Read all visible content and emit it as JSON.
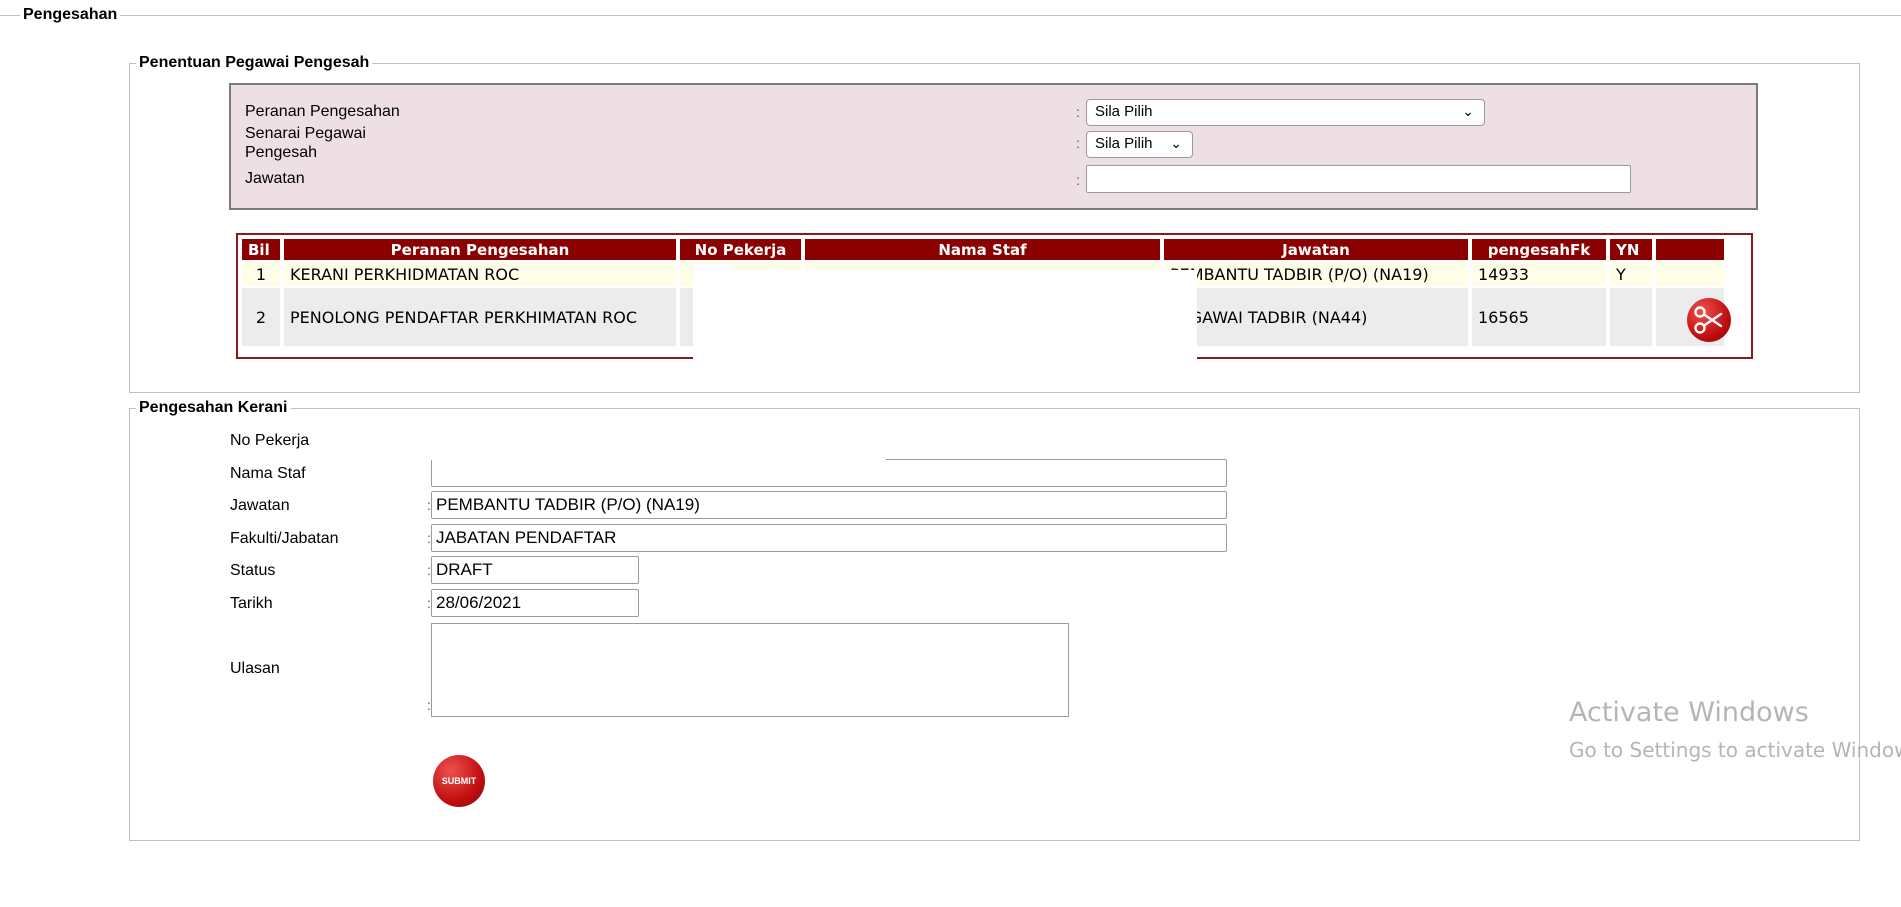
{
  "main": {
    "legend": "Pengesahan"
  },
  "assign": {
    "legend": "Penentuan Pegawai Pengesah",
    "role_label": "Peranan Pengesahan",
    "officer_label_1": "Senarai Pegawai",
    "officer_label_2": "Pengesah",
    "position_label": "Jawatan",
    "colon": ":",
    "role_select": "Sila Pilih",
    "officer_select": "Sila Pilih",
    "position_value": ""
  },
  "table": {
    "headers": [
      "Bil",
      "Peranan Pengesahan",
      "No Pekerja",
      "Nama Staf",
      "Jawatan",
      "pengesahFk",
      "YN",
      ""
    ],
    "rows": [
      [
        "1",
        "KERANI PERKHIDMATAN ROC",
        "",
        "",
        "PEMBANTU TADBIR (P/O) (NA19)",
        "14933",
        "Y"
      ],
      [
        "2",
        "PENOLONG PENDAFTAR PERKHIMATAN ROC",
        "",
        "",
        "PEGAWAI TADBIR (NA44)",
        "16565",
        ""
      ]
    ],
    "delete_icon": "scissors-icon"
  },
  "clerk": {
    "legend": "Pengesahan Kerani",
    "labels": {
      "no_pekerja": "No Pekerja",
      "nama_staf": "Nama Staf",
      "jawatan": "Jawatan",
      "fakulti": "Fakulti/Jabatan",
      "status": "Status",
      "tarikh": "Tarikh",
      "ulasan": "Ulasan"
    },
    "values": {
      "no_pekerja": "",
      "nama_staf": "",
      "jawatan": "PEMBANTU TADBIR (P/O) (NA19)",
      "fakulti": "JABATAN PENDAFTAR",
      "status": "DRAFT",
      "tarikh": "28/06/2021",
      "ulasan": ""
    },
    "submit_label": "SUBMIT"
  },
  "watermark": {
    "line1": "Activate Windows",
    "line2": "Go to Settings to activate Windows"
  },
  "colors": {
    "header_bg": "#8b0000",
    "panel_bg": "#eddfe4",
    "button_red": "#c01010"
  }
}
